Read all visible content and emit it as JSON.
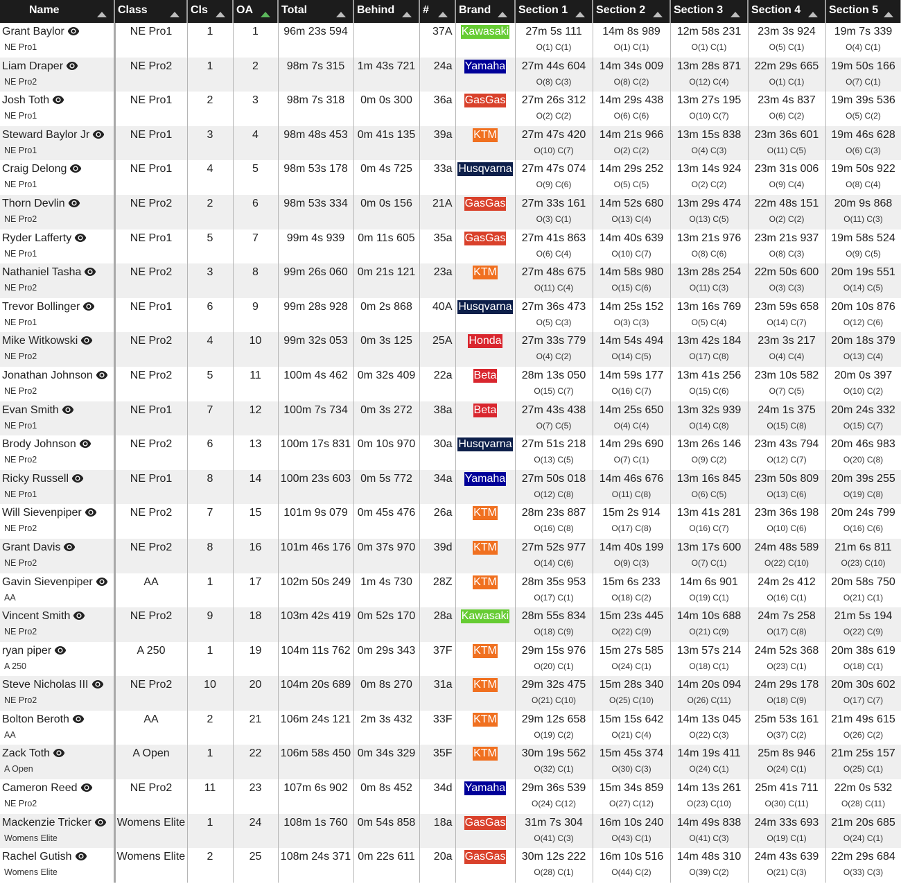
{
  "headers": [
    {
      "key": "name",
      "label": "Name",
      "sort": "none"
    },
    {
      "key": "class",
      "label": "Class",
      "sort": "none"
    },
    {
      "key": "cls",
      "label": "Cls",
      "sort": "none"
    },
    {
      "key": "oa",
      "label": "OA",
      "sort": "ascending-active"
    },
    {
      "key": "total",
      "label": "Total",
      "sort": "none"
    },
    {
      "key": "behind",
      "label": "Behind",
      "sort": "none"
    },
    {
      "key": "number",
      "label": "#",
      "sort": "none"
    },
    {
      "key": "brand",
      "label": "Brand",
      "sort": "none"
    },
    {
      "key": "s1",
      "label": "Section 1",
      "sort": "none"
    },
    {
      "key": "s2",
      "label": "Section 2",
      "sort": "none"
    },
    {
      "key": "s3",
      "label": "Section 3",
      "sort": "none"
    },
    {
      "key": "s4",
      "label": "Section 4",
      "sort": "none"
    },
    {
      "key": "s5",
      "label": "Section 5",
      "sort": "none"
    }
  ],
  "brand_colors": {
    "Kawasaki": "#66cc33",
    "Yamaha": "#000099",
    "GasGas": "#d9412b",
    "KTM": "#f07020",
    "Husqvarna": "#0d1f4a",
    "Honda": "#d9262e",
    "Beta": "#d9262e"
  },
  "accent_sort_color": "#5cb85c",
  "rows": [
    {
      "name": "Grant Baylor",
      "class": "NE Pro1",
      "cls": "1",
      "oa": "1",
      "total": "96m 23s 594",
      "behind": "",
      "number": "37A",
      "brand": "Kawasaki",
      "sections": [
        [
          "27m 5s 111",
          "O(1) C(1)"
        ],
        [
          "14m 8s 989",
          "O(1) C(1)"
        ],
        [
          "12m 58s 231",
          "O(1) C(1)"
        ],
        [
          "23m 3s 924",
          "O(5) C(1)"
        ],
        [
          "19m 7s 339",
          "O(4) C(1)"
        ]
      ]
    },
    {
      "name": "Liam Draper",
      "class": "NE Pro2",
      "cls": "1",
      "oa": "2",
      "total": "98m 7s 315",
      "behind": "1m 43s 721",
      "number": "24a",
      "brand": "Yamaha",
      "sections": [
        [
          "27m 44s 604",
          "O(8) C(3)"
        ],
        [
          "14m 34s 009",
          "O(8) C(2)"
        ],
        [
          "13m 28s 871",
          "O(12) C(4)"
        ],
        [
          "22m 29s 665",
          "O(1) C(1)"
        ],
        [
          "19m 50s 166",
          "O(7) C(1)"
        ]
      ]
    },
    {
      "name": "Josh Toth",
      "class": "NE Pro1",
      "cls": "2",
      "oa": "3",
      "total": "98m 7s 318",
      "behind": "0m 0s 300",
      "number": "36a",
      "brand": "GasGas",
      "sections": [
        [
          "27m 26s 312",
          "O(2) C(2)"
        ],
        [
          "14m 29s 438",
          "O(6) C(6)"
        ],
        [
          "13m 27s 195",
          "O(10) C(7)"
        ],
        [
          "23m 4s 837",
          "O(6) C(2)"
        ],
        [
          "19m 39s 536",
          "O(5) C(2)"
        ]
      ]
    },
    {
      "name": "Steward Baylor Jr",
      "class": "NE Pro1",
      "cls": "3",
      "oa": "4",
      "total": "98m 48s 453",
      "behind": "0m 41s 135",
      "number": "39a",
      "brand": "KTM",
      "sections": [
        [
          "27m 47s 420",
          "O(10) C(7)"
        ],
        [
          "14m 21s 966",
          "O(2) C(2)"
        ],
        [
          "13m 15s 838",
          "O(4) C(3)"
        ],
        [
          "23m 36s 601",
          "O(11) C(5)"
        ],
        [
          "19m 46s 628",
          "O(6) C(3)"
        ]
      ]
    },
    {
      "name": "Craig Delong",
      "class": "NE Pro1",
      "cls": "4",
      "oa": "5",
      "total": "98m 53s 178",
      "behind": "0m 4s 725",
      "number": "33a",
      "brand": "Husqvarna",
      "sections": [
        [
          "27m 47s 074",
          "O(9) C(6)"
        ],
        [
          "14m 29s 252",
          "O(5) C(5)"
        ],
        [
          "13m 14s 924",
          "O(2) C(2)"
        ],
        [
          "23m 31s 006",
          "O(9) C(4)"
        ],
        [
          "19m 50s 922",
          "O(8) C(4)"
        ]
      ]
    },
    {
      "name": "Thorn Devlin",
      "class": "NE Pro2",
      "cls": "2",
      "oa": "6",
      "total": "98m 53s 334",
      "behind": "0m 0s 156",
      "number": "21A",
      "brand": "GasGas",
      "sections": [
        [
          "27m 33s 161",
          "O(3) C(1)"
        ],
        [
          "14m 52s 680",
          "O(13) C(4)"
        ],
        [
          "13m 29s 474",
          "O(13) C(5)"
        ],
        [
          "22m 48s 151",
          "O(2) C(2)"
        ],
        [
          "20m 9s 868",
          "O(11) C(3)"
        ]
      ]
    },
    {
      "name": "Ryder Lafferty",
      "class": "NE Pro1",
      "cls": "5",
      "oa": "7",
      "total": "99m 4s 939",
      "behind": "0m 11s 605",
      "number": "35a",
      "brand": "GasGas",
      "sections": [
        [
          "27m 41s 863",
          "O(6) C(4)"
        ],
        [
          "14m 40s 639",
          "O(10) C(7)"
        ],
        [
          "13m 21s 976",
          "O(8) C(6)"
        ],
        [
          "23m 21s 937",
          "O(8) C(3)"
        ],
        [
          "19m 58s 524",
          "O(9) C(5)"
        ]
      ]
    },
    {
      "name": "Nathaniel Tasha",
      "class": "NE Pro2",
      "cls": "3",
      "oa": "8",
      "total": "99m 26s 060",
      "behind": "0m 21s 121",
      "number": "23a",
      "brand": "KTM",
      "sections": [
        [
          "27m 48s 675",
          "O(11) C(4)"
        ],
        [
          "14m 58s 980",
          "O(15) C(6)"
        ],
        [
          "13m 28s 254",
          "O(11) C(3)"
        ],
        [
          "22m 50s 600",
          "O(3) C(3)"
        ],
        [
          "20m 19s 551",
          "O(14) C(5)"
        ]
      ]
    },
    {
      "name": "Trevor Bollinger",
      "class": "NE Pro1",
      "cls": "6",
      "oa": "9",
      "total": "99m 28s 928",
      "behind": "0m 2s 868",
      "number": "40A",
      "brand": "Husqvarna",
      "sections": [
        [
          "27m 36s 473",
          "O(5) C(3)"
        ],
        [
          "14m 25s 152",
          "O(3) C(3)"
        ],
        [
          "13m 16s 769",
          "O(5) C(4)"
        ],
        [
          "23m 59s 658",
          "O(14) C(7)"
        ],
        [
          "20m 10s 876",
          "O(12) C(6)"
        ]
      ]
    },
    {
      "name": "Mike Witkowski",
      "class": "NE Pro2",
      "cls": "4",
      "oa": "10",
      "total": "99m 32s 053",
      "behind": "0m 3s 125",
      "number": "25A",
      "brand": "Honda",
      "sections": [
        [
          "27m 33s 779",
          "O(4) C(2)"
        ],
        [
          "14m 54s 494",
          "O(14) C(5)"
        ],
        [
          "13m 42s 184",
          "O(17) C(8)"
        ],
        [
          "23m 3s 217",
          "O(4) C(4)"
        ],
        [
          "20m 18s 379",
          "O(13) C(4)"
        ]
      ]
    },
    {
      "name": "Jonathan Johnson",
      "class": "NE Pro2",
      "cls": "5",
      "oa": "11",
      "total": "100m 4s 462",
      "behind": "0m 32s 409",
      "number": "22a",
      "brand": "Beta",
      "sections": [
        [
          "28m 13s 050",
          "O(15) C(7)"
        ],
        [
          "14m 59s 177",
          "O(16) C(7)"
        ],
        [
          "13m 41s 256",
          "O(15) C(6)"
        ],
        [
          "23m 10s 582",
          "O(7) C(5)"
        ],
        [
          "20m 0s 397",
          "O(10) C(2)"
        ]
      ]
    },
    {
      "name": "Evan Smith",
      "class": "NE Pro1",
      "cls": "7",
      "oa": "12",
      "total": "100m 7s 734",
      "behind": "0m 3s 272",
      "number": "38a",
      "brand": "Beta",
      "sections": [
        [
          "27m 43s 438",
          "O(7) C(5)"
        ],
        [
          "14m 25s 650",
          "O(4) C(4)"
        ],
        [
          "13m 32s 939",
          "O(14) C(8)"
        ],
        [
          "24m 1s 375",
          "O(15) C(8)"
        ],
        [
          "20m 24s 332",
          "O(15) C(7)"
        ]
      ]
    },
    {
      "name": "Brody Johnson",
      "class": "NE Pro2",
      "cls": "6",
      "oa": "13",
      "total": "100m 17s 831",
      "behind": "0m 10s 970",
      "number": "30a",
      "brand": "Husqvarna",
      "sections": [
        [
          "27m 51s 218",
          "O(13) C(5)"
        ],
        [
          "14m 29s 690",
          "O(7) C(1)"
        ],
        [
          "13m 26s 146",
          "O(9) C(2)"
        ],
        [
          "23m 43s 794",
          "O(12) C(7)"
        ],
        [
          "20m 46s 983",
          "O(20) C(8)"
        ]
      ]
    },
    {
      "name": "Ricky Russell",
      "class": "NE Pro1",
      "cls": "8",
      "oa": "14",
      "total": "100m 23s 603",
      "behind": "0m 5s 772",
      "number": "34a",
      "brand": "Yamaha",
      "sections": [
        [
          "27m 50s 018",
          "O(12) C(8)"
        ],
        [
          "14m 46s 676",
          "O(11) C(8)"
        ],
        [
          "13m 16s 845",
          "O(6) C(5)"
        ],
        [
          "23m 50s 809",
          "O(13) C(6)"
        ],
        [
          "20m 39s 255",
          "O(19) C(8)"
        ]
      ]
    },
    {
      "name": "Will Sievenpiper",
      "class": "NE Pro2",
      "cls": "7",
      "oa": "15",
      "total": "101m 9s 079",
      "behind": "0m 45s 476",
      "number": "26a",
      "brand": "KTM",
      "sections": [
        [
          "28m 23s 887",
          "O(16) C(8)"
        ],
        [
          "15m 2s 914",
          "O(17) C(8)"
        ],
        [
          "13m 41s 281",
          "O(16) C(7)"
        ],
        [
          "23m 36s 198",
          "O(10) C(6)"
        ],
        [
          "20m 24s 799",
          "O(16) C(6)"
        ]
      ]
    },
    {
      "name": "Grant Davis",
      "class": "NE Pro2",
      "cls": "8",
      "oa": "16",
      "total": "101m 46s 176",
      "behind": "0m 37s 970",
      "number": "39d",
      "brand": "KTM",
      "sections": [
        [
          "27m 52s 977",
          "O(14) C(6)"
        ],
        [
          "14m 40s 199",
          "O(9) C(3)"
        ],
        [
          "13m 17s 600",
          "O(7) C(1)"
        ],
        [
          "24m 48s 589",
          "O(22) C(10)"
        ],
        [
          "21m 6s 811",
          "O(23) C(10)"
        ]
      ]
    },
    {
      "name": "Gavin Sievenpiper",
      "class": "AA",
      "cls": "1",
      "oa": "17",
      "total": "102m 50s 249",
      "behind": "1m 4s 730",
      "number": "28Z",
      "brand": "KTM",
      "sections": [
        [
          "28m 35s 953",
          "O(17) C(1)"
        ],
        [
          "15m 6s 233",
          "O(18) C(2)"
        ],
        [
          "14m 6s 901",
          "O(19) C(1)"
        ],
        [
          "24m 2s 412",
          "O(16) C(1)"
        ],
        [
          "20m 58s 750",
          "O(21) C(1)"
        ]
      ]
    },
    {
      "name": "Vincent Smith",
      "class": "NE Pro2",
      "cls": "9",
      "oa": "18",
      "total": "103m 42s 419",
      "behind": "0m 52s 170",
      "number": "28a",
      "brand": "Kawasaki",
      "sections": [
        [
          "28m 55s 834",
          "O(18) C(9)"
        ],
        [
          "15m 23s 445",
          "O(22) C(9)"
        ],
        [
          "14m 10s 688",
          "O(21) C(9)"
        ],
        [
          "24m 7s 258",
          "O(17) C(8)"
        ],
        [
          "21m 5s 194",
          "O(22) C(9)"
        ]
      ]
    },
    {
      "name": "ryan piper",
      "class": "A 250",
      "cls": "1",
      "oa": "19",
      "total": "104m 11s 762",
      "behind": "0m 29s 343",
      "number": "37F",
      "brand": "KTM",
      "sections": [
        [
          "29m 15s 976",
          "O(20) C(1)"
        ],
        [
          "15m 27s 585",
          "O(24) C(1)"
        ],
        [
          "13m 57s 214",
          "O(18) C(1)"
        ],
        [
          "24m 52s 368",
          "O(23) C(1)"
        ],
        [
          "20m 38s 619",
          "O(18) C(1)"
        ]
      ]
    },
    {
      "name": "Steve Nicholas III",
      "class": "NE Pro2",
      "cls": "10",
      "oa": "20",
      "total": "104m 20s 689",
      "behind": "0m 8s 270",
      "number": "31a",
      "brand": "KTM",
      "sections": [
        [
          "29m 32s 475",
          "O(21) C(10)"
        ],
        [
          "15m 28s 340",
          "O(25) C(10)"
        ],
        [
          "14m 20s 094",
          "O(26) C(11)"
        ],
        [
          "24m 29s 178",
          "O(18) C(9)"
        ],
        [
          "20m 30s 602",
          "O(17) C(7)"
        ]
      ]
    },
    {
      "name": "Bolton Beroth",
      "class": "AA",
      "cls": "2",
      "oa": "21",
      "total": "106m 24s 121",
      "behind": "2m 3s 432",
      "number": "33F",
      "brand": "KTM",
      "sections": [
        [
          "29m 12s 658",
          "O(19) C(2)"
        ],
        [
          "15m 15s 642",
          "O(21) C(4)"
        ],
        [
          "14m 13s 045",
          "O(22) C(3)"
        ],
        [
          "25m 53s 161",
          "O(37) C(2)"
        ],
        [
          "21m 49s 615",
          "O(26) C(2)"
        ]
      ]
    },
    {
      "name": "Zack Toth",
      "class": "A Open",
      "cls": "1",
      "oa": "22",
      "total": "106m 58s 450",
      "behind": "0m 34s 329",
      "number": "35F",
      "brand": "KTM",
      "sections": [
        [
          "30m 19s 562",
          "O(32) C(1)"
        ],
        [
          "15m 45s 374",
          "O(30) C(3)"
        ],
        [
          "14m 19s 411",
          "O(24) C(1)"
        ],
        [
          "25m 8s 946",
          "O(24) C(1)"
        ],
        [
          "21m 25s 157",
          "O(25) C(1)"
        ]
      ]
    },
    {
      "name": "Cameron Reed",
      "class": "NE Pro2",
      "cls": "11",
      "oa": "23",
      "total": "107m 6s 902",
      "behind": "0m 8s 452",
      "number": "34d",
      "brand": "Yamaha",
      "sections": [
        [
          "29m 36s 539",
          "O(24) C(12)"
        ],
        [
          "15m 34s 859",
          "O(27) C(12)"
        ],
        [
          "14m 13s 261",
          "O(23) C(10)"
        ],
        [
          "25m 41s 711",
          "O(30) C(11)"
        ],
        [
          "22m 0s 532",
          "O(28) C(11)"
        ]
      ]
    },
    {
      "name": "Mackenzie Tricker",
      "class": "Womens Elite",
      "cls": "1",
      "oa": "24",
      "total": "108m 1s 760",
      "behind": "0m 54s 858",
      "number": "18a",
      "brand": "GasGas",
      "sections": [
        [
          "31m 7s 304",
          "O(41) C(3)"
        ],
        [
          "16m 10s 240",
          "O(43) C(1)"
        ],
        [
          "14m 49s 838",
          "O(41) C(3)"
        ],
        [
          "24m 33s 693",
          "O(19) C(1)"
        ],
        [
          "21m 20s 685",
          "O(24) C(1)"
        ]
      ]
    },
    {
      "name": "Rachel Gutish",
      "class": "Womens Elite",
      "cls": "2",
      "oa": "25",
      "total": "108m 24s 371",
      "behind": "0m 22s 611",
      "number": "20a",
      "brand": "GasGas",
      "sections": [
        [
          "30m 12s 222",
          "O(28) C(1)"
        ],
        [
          "16m 10s 516",
          "O(44) C(2)"
        ],
        [
          "14m 48s 310",
          "O(39) C(2)"
        ],
        [
          "24m 43s 639",
          "O(21) C(3)"
        ],
        [
          "22m 29s 684",
          "O(33) C(3)"
        ]
      ]
    }
  ]
}
